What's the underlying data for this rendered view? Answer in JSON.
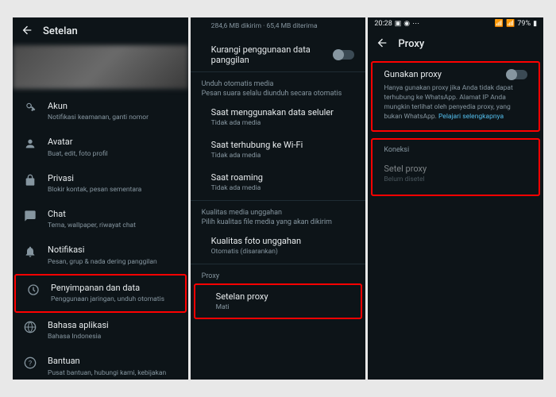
{
  "panel1": {
    "header": "Setelan",
    "items": [
      {
        "title": "Akun",
        "subtitle": "Notifikasi keamanan, ganti nomor"
      },
      {
        "title": "Avatar",
        "subtitle": "Buat, edit, foto profil"
      },
      {
        "title": "Privasi",
        "subtitle": "Blokir kontak, pesan sementara"
      },
      {
        "title": "Chat",
        "subtitle": "Tema, wallpaper, riwayat chat"
      },
      {
        "title": "Notifikasi",
        "subtitle": "Pesan, grup & nada dering panggilan"
      },
      {
        "title": "Penyimpanan dan data",
        "subtitle": "Penggunaan jaringan, unduh otomatis"
      },
      {
        "title": "Bahasa aplikasi",
        "subtitle": "Bahasa Indonesia"
      },
      {
        "title": "Bantuan",
        "subtitle": "Pusat bantuan, hubungi kami, kebijakan"
      }
    ]
  },
  "panel2": {
    "data_usage": "284,6 MB dikirim · 65,4 MB diterima",
    "reduce_data": "Kurangi penggunaan data panggilan",
    "section_auto": "Unduh otomatis media",
    "section_auto_sub": "Pesan suara selalu diunduh secara otomatis",
    "auto_items": [
      {
        "title": "Saat menggunakan data seluler",
        "subtitle": "Tidak ada media"
      },
      {
        "title": "Saat terhubung ke Wi-Fi",
        "subtitle": "Tidak ada media"
      },
      {
        "title": "Saat roaming",
        "subtitle": "Tidak ada media"
      }
    ],
    "section_quality": "Kualitas media unggahan",
    "section_quality_sub": "Pilih kualitas file media yang akan dikirim",
    "quality_item": {
      "title": "Kualitas foto unggahan",
      "subtitle": "Otomatis (disarankan)"
    },
    "section_proxy": "Proxy",
    "proxy_item": {
      "title": "Setelan proxy",
      "subtitle": "Mati"
    }
  },
  "panel3": {
    "status_time": "20:28",
    "battery": "79%",
    "header": "Proxy",
    "use_proxy": "Gunakan proxy",
    "use_proxy_desc": "Hanya gunakan proxy jika Anda tidak dapat terhubung ke WhatsApp. Alamat IP Anda mungkin terlihat oleh penyedia proxy, yang bukan WhatsApp.",
    "learn_more": "Pelajari selengkapnya",
    "section_connection": "Koneksi",
    "set_proxy": "Setel proxy",
    "not_set": "Belum disetel"
  }
}
